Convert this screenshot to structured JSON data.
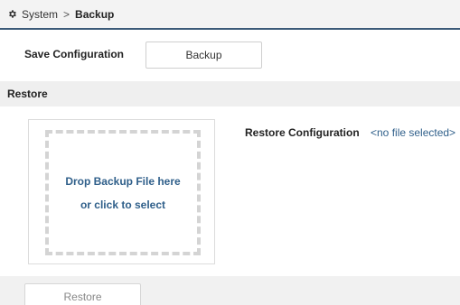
{
  "breadcrumb": {
    "icon": "gear-icon",
    "parent": "System",
    "separator": ">",
    "current": "Backup"
  },
  "save": {
    "label": "Save Configuration",
    "button_label": "Backup"
  },
  "restore_section": {
    "title": "Restore"
  },
  "dropzone": {
    "line1": "Drop Backup File here",
    "line2": "or click to select"
  },
  "restore_config": {
    "label": "Restore Configuration",
    "status": "<no file selected>"
  },
  "footer": {
    "restore_button_label": "Restore"
  },
  "colors": {
    "accent": "#3c5a78",
    "link": "#2f5f8a"
  }
}
